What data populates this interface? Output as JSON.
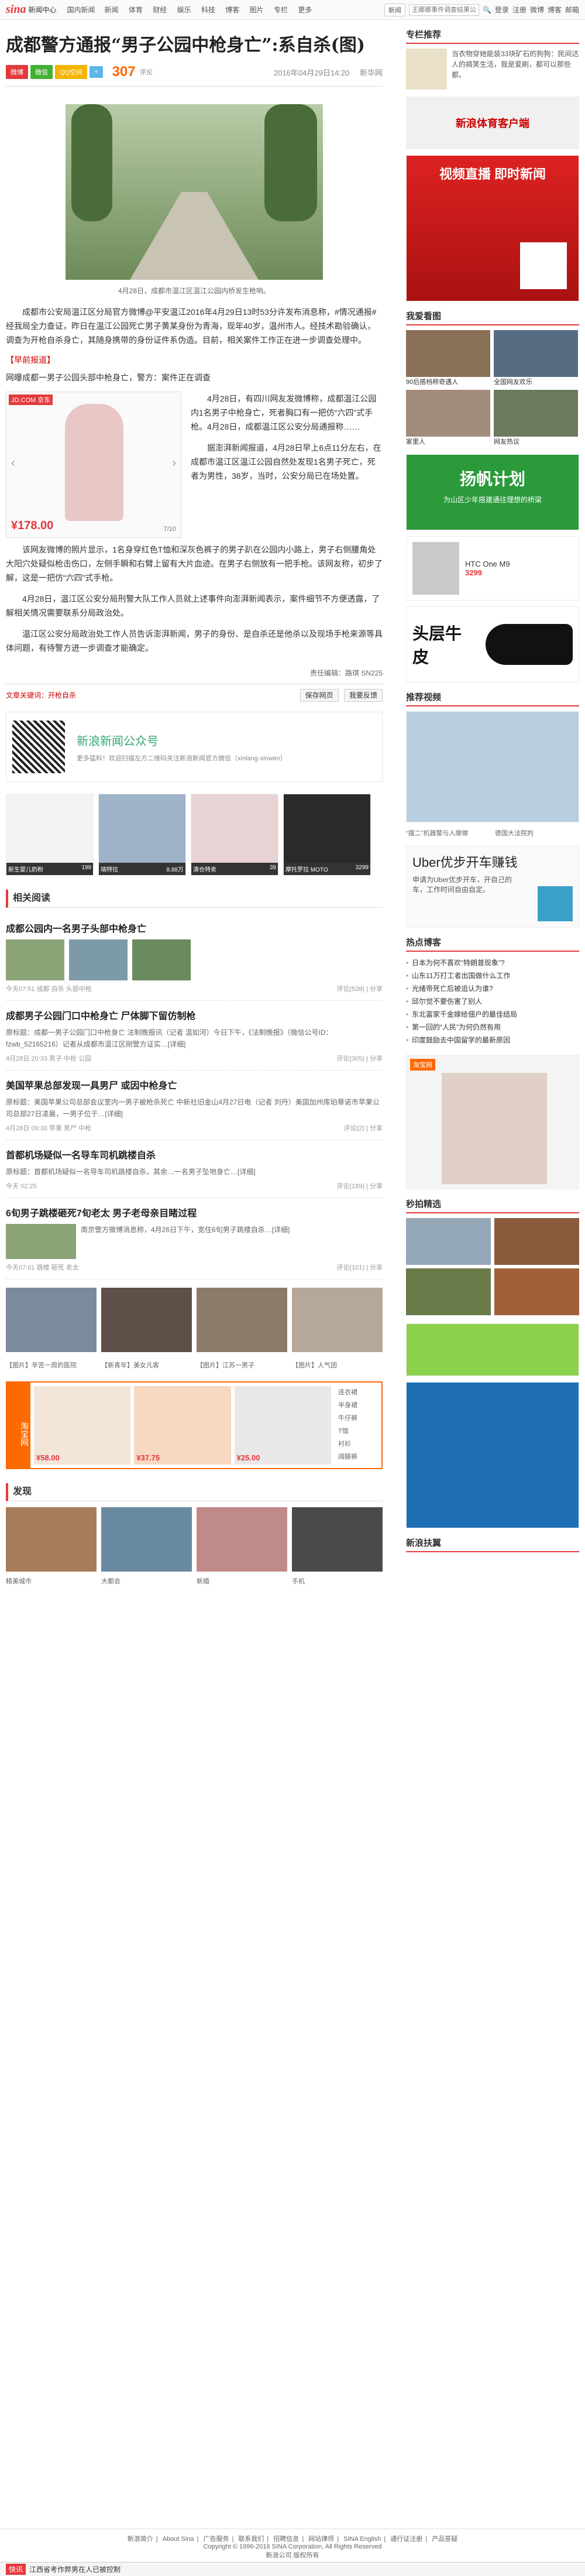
{
  "topbar": {
    "logo": "sina",
    "logo_sub": "新闻中心",
    "crumb": "国内新闻",
    "nav": [
      "新闻",
      "体育",
      "财经",
      "娱乐",
      "科技",
      "博客",
      "图片",
      "专栏",
      "更多"
    ],
    "select": "新闻",
    "search_placeholder": "王娜娜事件调查结果公布",
    "login": "登录",
    "register": "注册",
    "weibo": "微博",
    "blog": "博客",
    "mail": "邮箱",
    "weather_label": "天气"
  },
  "article": {
    "title": "成都警方通报“男子公园中枪身亡”:系自杀(图)",
    "share": [
      "微博",
      "微信",
      "QQ空间"
    ],
    "comments": "307",
    "comments_label": "评论",
    "datetime": "2016年04月29日14:20",
    "source": "新华网",
    "photo_caption": "4月28日，成都市温江区温江公园内桥发生枪响。",
    "p1": "成都市公安局温江区分局官方微博@平安温江2016年4月29日13时53分许发布消息称，#情况通报#经我局全力查证，昨日在温江公园死亡男子黄某身份为青海，现年40岁，温州市人。经技术勘验确认，调查为开枪自杀身亡，其随身携带的身份证件系伪造。目前，相关案件工作正在进一步调查处理中。",
    "sub1": "【早前报道】",
    "p2": "网曝成都一男子公园头部中枪身亡，警方：案件正在调查",
    "p3": "4月28日，有四川网友发微博称，成都温江公园内1名男子中枪身亡，死者胸口有一把仿“六四”式手枪。4月28日，成都温江区公安分局通报称……",
    "p4": "据澎湃新闻报道，4月28日早上6点11分左右，在成都市温江区温江公园自然处发现1名男子死亡，死者为男性，38岁，当时，公安分局已在场处置。",
    "p5": "该网友微博的照片显示，1名身穿红色T恤和深灰色裤子的男子趴在公园内小路上，男子右侧腰角处大阳穴处疑似枪击伤口，左侧手瞬和右臂上留有大片血迹。在男子右侧放有一把手枪。该网友称，初步了解，这是一把仿“六四”式手枪。",
    "p6": "4月28日，温江区公安分局刑警大队工作人员就上述事件向澎湃新闻表示，案件细节不方便透露，了解相关情况需要联系分局政治处。",
    "p7": "温江区公安分局政治处工作人员告诉澎湃新闻，男子的身份、是自杀还是他杀以及现场手枪来源等具体问题，有待警方进一步调查才能确定。",
    "editor": "责任编辑：路琪 SN225",
    "tags_label": "文章关键词：开枪自杀",
    "btn_save": "保存网页",
    "btn_report": "我要反馈"
  },
  "inline_ad": {
    "badge": "JD.COM 京东",
    "price": "¥178.00",
    "page": "7/10"
  },
  "wechat": {
    "title": "新浪新闻公众号",
    "desc": "更多猛料！欢迎扫描左方二维码关注新浪新闻官方微信（xinlang-xinwen）"
  },
  "products": [
    {
      "name": "新生婴儿奶粉",
      "price": "199"
    },
    {
      "name": "瑞特拉",
      "price": "8.88万"
    },
    {
      "name": "清仓特卖",
      "price": "39"
    },
    {
      "name": "摩托罗拉 MOTO",
      "price": "3299"
    }
  ],
  "related_title": "相关阅读",
  "news": [
    {
      "title": "成都公园内一名男子头部中枪身亡",
      "time": "今天07:51",
      "tags": "成都 自杀 头部中枪",
      "comments": "评论(539)",
      "share": "分享"
    },
    {
      "title": "成都男子公园门口中枪身亡 尸体脚下留仿制枪",
      "desc": "原标题：成都一男子公园门口中枪身亡 法制晚报讯（记者 温如河）今日下午，《法制晚报》（微信公号ID：fzwb_52165216）记者从成都市温江区刚警方证实…[详细]",
      "time": "4月28日 20:33",
      "tags": "男子 中枪 公园",
      "comments": "评论(305)",
      "share": "分享"
    },
    {
      "title": "美国苹果总部发现一具男尸 或因中枪身亡",
      "desc": "原标题：美国苹果公司总部会议室内一男子被枪杀死亡 中新社旧金山4月27日电（记者 刘丹）美国加州库珀蒂诺市苹果公司总部27日凌晨，一男子位于…[详细]",
      "time": "4月28日 09:30",
      "tags": "苹果 男尸 中枪",
      "comments": "评论(2)",
      "share": "分享"
    },
    {
      "title": "首都机场疑似一名导车司机跳楼自杀",
      "desc": "原标题：首都机场疑似一名导车司机跳楼自杀，其余…一名男子坠地身亡…[详细]",
      "time": "今天 02:25",
      "tags": "首都机场",
      "comments": "评论(189)",
      "share": "分享"
    },
    {
      "title": "6旬男子跳楼砸死7旬老太 男子老母亲目睹过程",
      "desc": "南京警方微博消息称，4月26日下午，宽住6旬男子跳楼自杀…[详细]",
      "time": "今天07:01",
      "tags": "跳楼 砸死 老太",
      "comments": "评论(101)",
      "share": "分享"
    }
  ],
  "gallery_caption": [
    "【图片】辛苦一周的医院",
    "【新青年】美女凡客",
    "【图片】江苏一男子",
    "【图片】人气团"
  ],
  "taobao": {
    "label": "淘宝网",
    "items": [
      {
        "price": "¥58.00"
      },
      {
        "price": "¥37.75"
      },
      {
        "price": "¥25.00"
      }
    ],
    "cats": [
      "连衣裙",
      "半身裙",
      "牛仔裤",
      "T恤",
      "衬衫",
      "阔腿裤"
    ]
  },
  "recommend_title": "发现",
  "grid_caption": [
    "精美城市",
    "大都会",
    "新婚",
    "手机"
  ],
  "sidebar": {
    "hot_title": "专栏推荐",
    "hot_text": "当衣物穿她能装33块矿石的狗狗：民间达人的搞笑生活，我是爱刷，都可以那些都。",
    "sports_label": "新浪体育客户端",
    "video_text": "视频直播 即时新闻",
    "viewed_title": "我爱看图",
    "viewed": [
      "90后搭档称奇遇人",
      "全国网友欢乐",
      "家里人",
      "网友热议"
    ],
    "yangfan": "扬帆计划",
    "yangfan_sub": "为山区少年搭建通往理想的桥梁",
    "phone": "HTC One M9",
    "phone_price": "3299",
    "shoe": "头层牛皮",
    "video_rec": "推荐视频",
    "video_caps": [
      "“摆二”机器警与人摩擦",
      "德国大法院判"
    ],
    "uber_title": "Uber优步开车赚钱",
    "uber_sub": "申请为Uber优步开车，开自己的车，工作时间自由自定。",
    "hot_blog": "热点博客",
    "blog_list": [
      "日本为何不喜欢“特朗普现象”?",
      "山东11万打工者出国做什么工作",
      "光绪帝死亡后被追认为谁?",
      "邱尔觉不要伤害了别人",
      "东北富家千金嫁给佃户的最佳结局",
      "第一回的“人民”为何仍然有用",
      "印度鼓励去中国留学的最新原因"
    ],
    "taobao_label": "淘宝网",
    "sec_pick": "秒拍精选",
    "reader": "新浪扶翼"
  },
  "footer": {
    "links": [
      "新浪简介",
      "About Sina",
      "广告服务",
      "联系我们",
      "招聘信息",
      "网站律师",
      "SINA English",
      "通行证注册",
      "产品答疑"
    ],
    "copyright": "Copyright © 1996-2016 SINA Corporation, All Rights Reserved",
    "company": "新浪公司 版权所有"
  },
  "bottom": {
    "badge": "快讯",
    "text": "江西省考作弊男在人已被控制"
  }
}
